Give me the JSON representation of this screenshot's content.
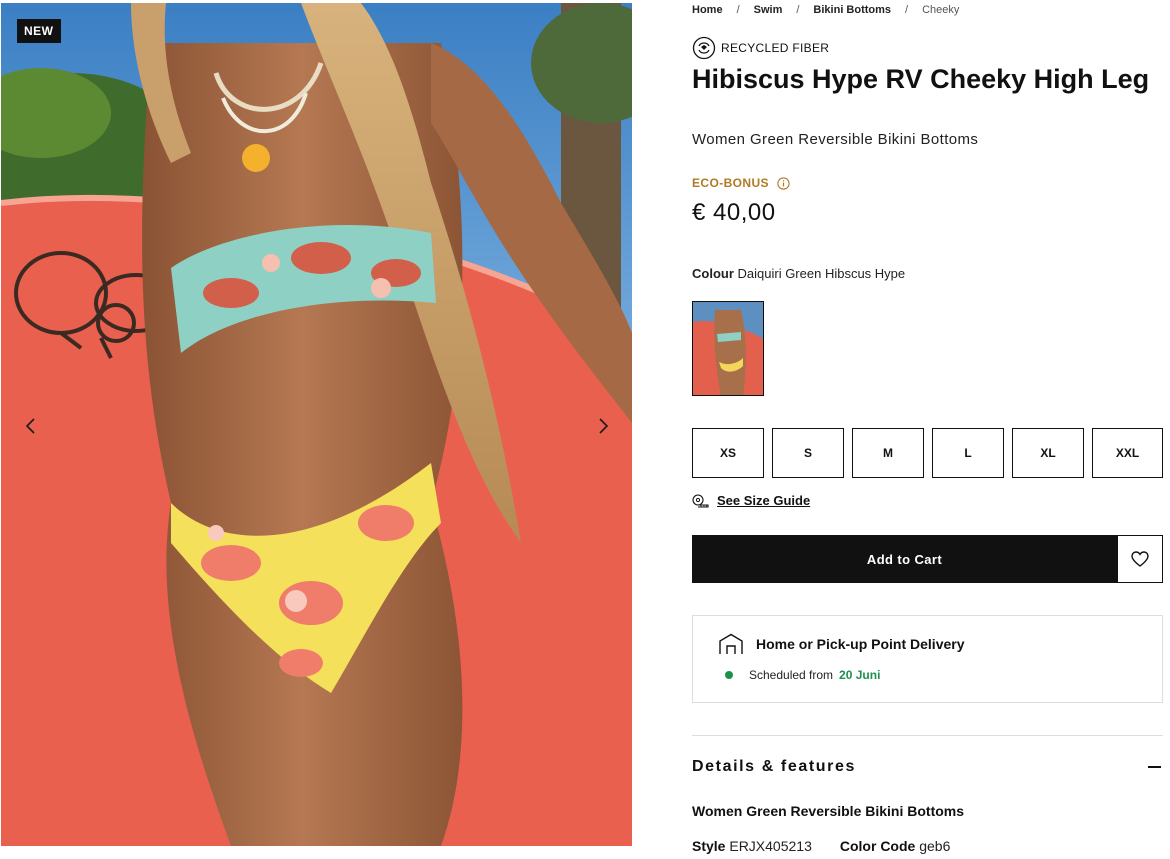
{
  "gallery": {
    "badge": "NEW",
    "prev_icon": "chevron-left-icon",
    "next_icon": "chevron-right-icon"
  },
  "breadcrumb": {
    "items": [
      "Home",
      "Swim",
      "Bikini Bottoms"
    ],
    "current": "Cheeky",
    "separator": "/"
  },
  "product": {
    "tag": "RECYCLED FIBER",
    "title": "Hibiscus Hype RV Cheeky High Leg",
    "subtitle": "Women Green Reversible Bikini Bottoms",
    "eco_label": "ECO-BONUS",
    "price": "€ 40,00",
    "colour_label": "Colour",
    "colour_value": "Daiquiri Green Hibscus Hype",
    "sizes": [
      "XS",
      "S",
      "M",
      "L",
      "XL",
      "XXL"
    ],
    "size_guide": "See Size Guide",
    "add_to_cart": "Add to Cart"
  },
  "delivery": {
    "title": "Home or Pick-up Point Delivery",
    "scheduled_label": "Scheduled from",
    "date": "20 Juni"
  },
  "details": {
    "heading": "Details & features",
    "subheading": "Women Green Reversible Bikini Bottoms",
    "style_label": "Style",
    "style_value": "ERJX405213",
    "color_code_label": "Color Code",
    "color_code_value": "geb6"
  },
  "colors": {
    "eco": "#b07a25",
    "delivery_green": "#1f8f4e",
    "button_dark": "#111111"
  }
}
